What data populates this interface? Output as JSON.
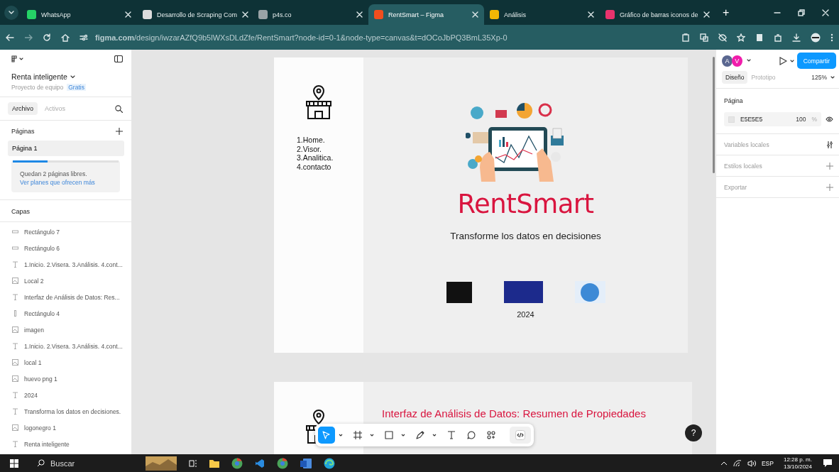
{
  "browser": {
    "tabs": [
      {
        "title": "WhatsApp",
        "selected": false,
        "color": "#25d366"
      },
      {
        "title": "Desarrollo de Scraping Com",
        "selected": false,
        "color": "#dddddd"
      },
      {
        "title": "p4s.co",
        "selected": false,
        "color": "#9aa3a6"
      },
      {
        "title": "RentSmart – Figma",
        "selected": true,
        "color": "#f24e1e"
      },
      {
        "title": "Análisis",
        "selected": false,
        "color": "#f2b705"
      },
      {
        "title": "Gráfico de barras iconos de",
        "selected": false,
        "color": "#e8336d"
      }
    ],
    "new_tab": "+",
    "address": "**figma.com**/design/iwzarAZfQ9b5lWXsDLdZfe/RentSmart?node-id=0-1&node-type=canvas&t=dOCoJbPQ3BmL35Xp-0"
  },
  "left_panel": {
    "file_name": "Renta inteligente",
    "project": "Proyecto de equipo",
    "plan": "Gratis",
    "tabs": [
      {
        "label": "Archivo",
        "selected": true
      },
      {
        "label": "Activos",
        "selected": false
      }
    ],
    "pages_heading": "Páginas",
    "pages": [
      {
        "label": "Página 1",
        "selected": true
      }
    ],
    "quota": {
      "level": 0.33,
      "text": "Quedan 2 páginas libres.",
      "link": "Ver planes que ofrecen más"
    },
    "layers_heading": "Capas",
    "layers": [
      {
        "kind": "rect",
        "name": "Rectángulo 7"
      },
      {
        "kind": "rect",
        "name": "Rectángulo 6"
      },
      {
        "kind": "text",
        "name": "1.Inicio. 2.Visera. 3.Análisis. 4.cont..."
      },
      {
        "kind": "image",
        "name": "Local 2"
      },
      {
        "kind": "text",
        "name": "Interfaz de Análisis de Datos: Res..."
      },
      {
        "kind": "line",
        "name": "Rectángulo 4"
      },
      {
        "kind": "image",
        "name": "imagen"
      },
      {
        "kind": "text",
        "name": "1.Inicio. 2.Visera. 3.Análisis. 4.cont..."
      },
      {
        "kind": "image",
        "name": "local 1"
      },
      {
        "kind": "image",
        "name": "huevo png 1"
      },
      {
        "kind": "text",
        "name": "2024"
      },
      {
        "kind": "text",
        "name": "Transforma los datos en decisiones."
      },
      {
        "kind": "image",
        "name": "logonegro 1"
      },
      {
        "kind": "text",
        "name": "Renta inteligente"
      }
    ]
  },
  "canvas": {
    "frame_1": {
      "menu": [
        "1.Home.",
        "2.Visor.",
        "3.Analitica.",
        "4.contacto"
      ],
      "title": "RentSmart",
      "subtitle": "Transforme los datos en decisiones",
      "year": "2024"
    },
    "frame_2": {
      "title": "Interfaz de Análisis de Datos: Resumen de Propiedades"
    }
  },
  "toolbar": {
    "tools": [
      {
        "kind": "move",
        "selected": true
      },
      {
        "kind": "frame",
        "selected": false
      },
      {
        "kind": "rect",
        "selected": false
      },
      {
        "kind": "pen",
        "selected": false
      },
      {
        "kind": "text",
        "selected": false
      },
      {
        "kind": "comment",
        "selected": false
      },
      {
        "kind": "actions",
        "selected": false
      },
      {
        "kind": "dev",
        "selected": false
      }
    ]
  },
  "help": "?",
  "right_panel": {
    "avatars": [
      {
        "initial": "A",
        "color": "#5a6790"
      },
      {
        "initial": "V",
        "color": "#f01dab"
      }
    ],
    "share": "Compartir",
    "tabs": [
      {
        "label": "Diseño",
        "selected": true
      },
      {
        "label": "Prototipo",
        "selected": false
      }
    ],
    "zoom": "125%",
    "page_heading": "Página",
    "fill": "E5E5E5",
    "opacity": "100",
    "unit": "%",
    "sections": [
      {
        "label": "Variables locales",
        "kind": "variables"
      },
      {
        "label": "Estilos locales",
        "kind": "add"
      },
      {
        "label": "Exportar",
        "kind": "add"
      }
    ]
  },
  "taskbar": {
    "search": "Buscar",
    "language": "ESP",
    "time": "12:28 p. m.",
    "date": "13/10/2024"
  }
}
